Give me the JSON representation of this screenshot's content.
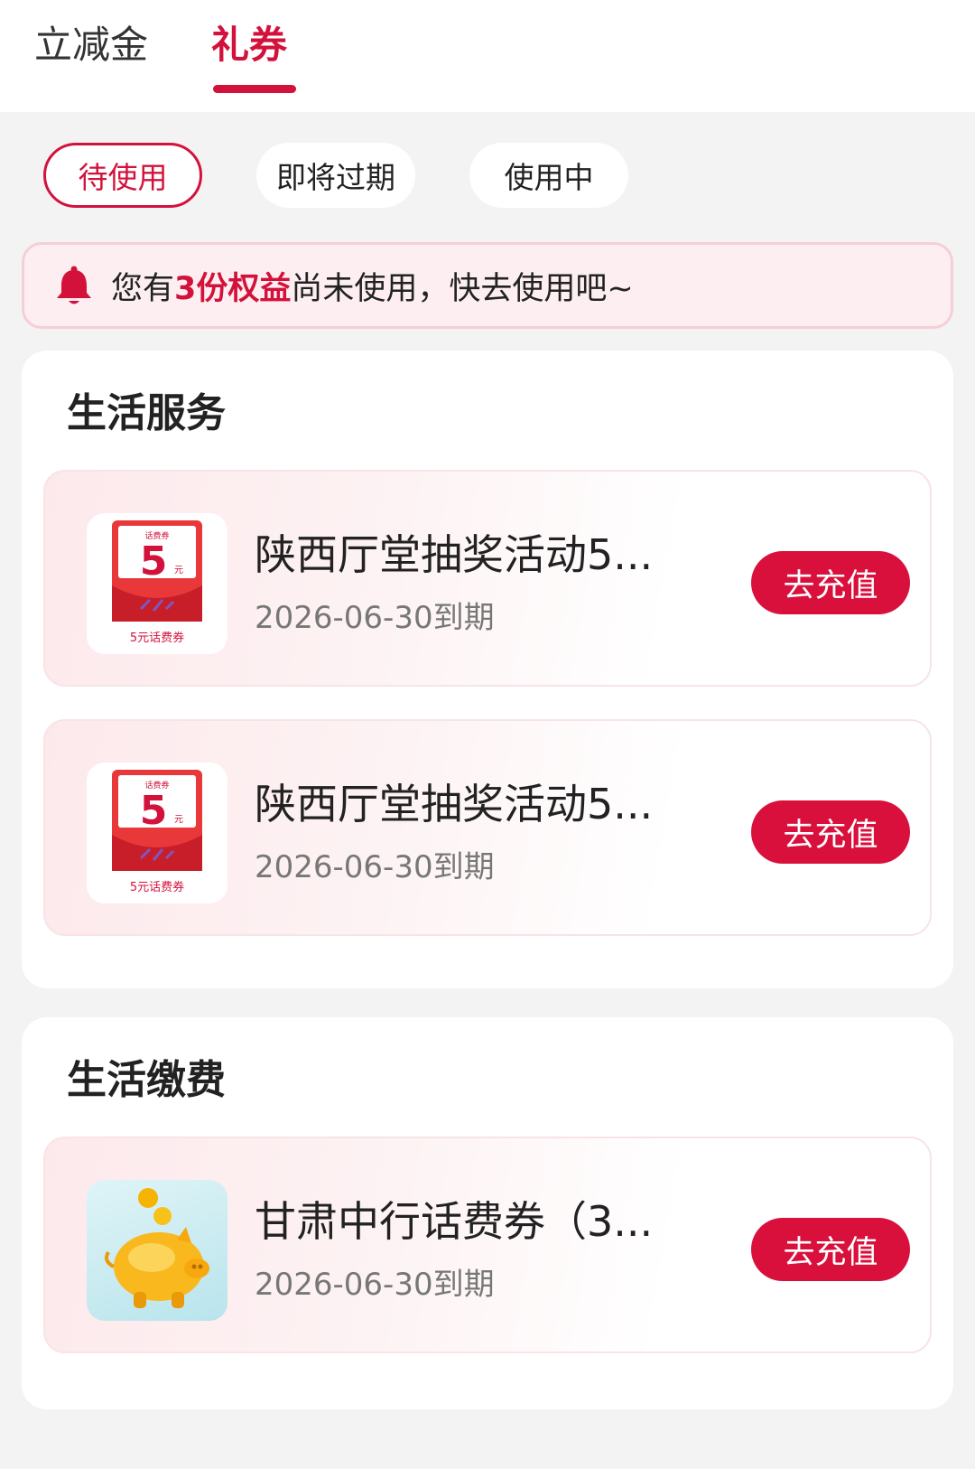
{
  "tabs": [
    {
      "label": "立减金",
      "active": false
    },
    {
      "label": "礼券",
      "active": true
    }
  ],
  "filters": [
    {
      "label": "待使用",
      "selected": true
    },
    {
      "label": "即将过期",
      "selected": false
    },
    {
      "label": "使用中",
      "selected": false
    }
  ],
  "notice": {
    "icon": "bell-icon",
    "prefix": "您有",
    "highlight": "3份权益",
    "suffix": "尚未使用，快去使用吧~"
  },
  "sections": [
    {
      "title": "生活服务",
      "items": [
        {
          "name": "陕西厅堂抽奖活动5...",
          "expiry": "2026-06-30到期",
          "button": "去充值",
          "thumb": {
            "top": "话费券",
            "amount": "5",
            "unit": "元",
            "caption": "5元话费券"
          }
        },
        {
          "name": "陕西厅堂抽奖活动5...",
          "expiry": "2026-06-30到期",
          "button": "去充值",
          "thumb": {
            "top": "话费券",
            "amount": "5",
            "unit": "元",
            "caption": "5元话费券"
          }
        }
      ]
    },
    {
      "title": "生活缴费",
      "items": [
        {
          "name": "甘肃中行话费券（3...",
          "expiry": "2026-06-30到期",
          "button": "去充值",
          "thumb_icon": "piggy-bank-icon"
        }
      ]
    }
  ],
  "colors": {
    "accent": "#d3123c",
    "background": "#f3f3f3"
  }
}
